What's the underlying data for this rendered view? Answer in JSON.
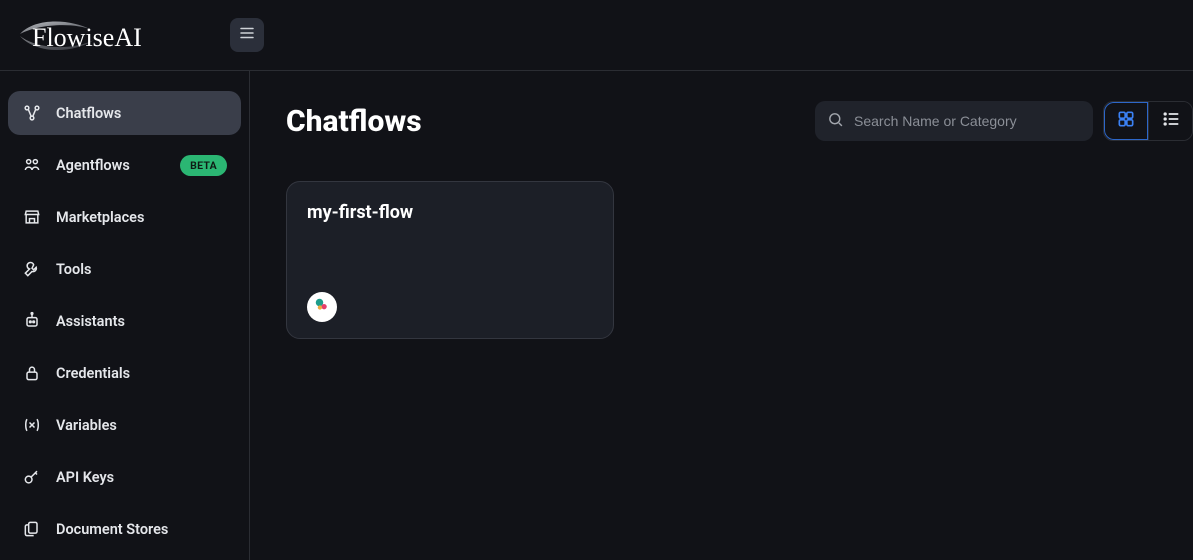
{
  "brand": {
    "name": "FlowiseAI"
  },
  "sidebar": {
    "items": [
      {
        "label": "Chatflows",
        "active": true
      },
      {
        "label": "Agentflows",
        "badge": "BETA"
      },
      {
        "label": "Marketplaces"
      },
      {
        "label": "Tools"
      },
      {
        "label": "Assistants"
      },
      {
        "label": "Credentials"
      },
      {
        "label": "Variables"
      },
      {
        "label": "API Keys"
      },
      {
        "label": "Document Stores"
      }
    ]
  },
  "main": {
    "title": "Chatflows",
    "search": {
      "placeholder": "Search Name or Category"
    },
    "cards": [
      {
        "title": "my-first-flow"
      }
    ]
  }
}
